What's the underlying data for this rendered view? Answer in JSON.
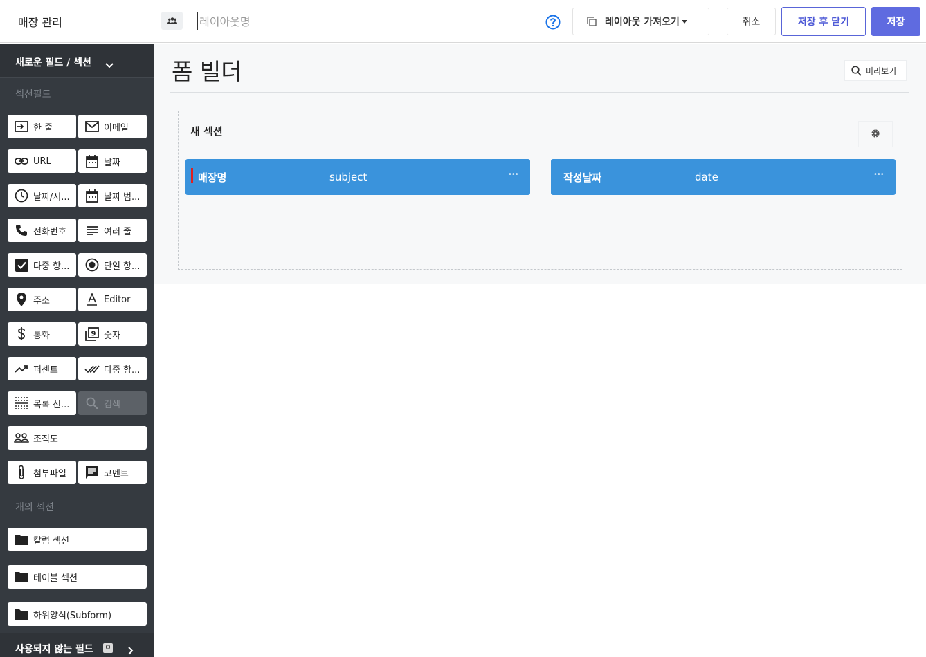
{
  "header": {
    "app_title": "매장 관리",
    "layout_name_value": "",
    "layout_name_placeholder": "레이아웃명",
    "import_label": "레이아웃 가져오기",
    "cancel_label": "취소",
    "save_close_label": "저장 후 닫기",
    "save_label": "저장"
  },
  "sidebar": {
    "header_label": "새로운 필드 / 섹션",
    "fields_category": "섹션필드",
    "fields": [
      {
        "label": "한 줄",
        "icon": "single-line-icon"
      },
      {
        "label": "이메일",
        "icon": "email-icon"
      },
      {
        "label": "URL",
        "icon": "link-icon"
      },
      {
        "label": "날짜",
        "icon": "calendar-icon"
      },
      {
        "label": "날짜/시...",
        "icon": "clock-icon"
      },
      {
        "label": "날짜 범...",
        "icon": "calendar-range-icon"
      },
      {
        "label": "전화번호",
        "icon": "phone-icon"
      },
      {
        "label": "여러 줄",
        "icon": "multiline-icon"
      },
      {
        "label": "다중 항...",
        "icon": "checkbox-icon"
      },
      {
        "label": "단일 항...",
        "icon": "radio-icon"
      },
      {
        "label": "주소",
        "icon": "location-pin-icon"
      },
      {
        "label": "Editor",
        "icon": "text-format-icon"
      },
      {
        "label": "통화",
        "icon": "dollar-icon"
      },
      {
        "label": "숫자",
        "icon": "number-icon"
      },
      {
        "label": "퍼센트",
        "icon": "trending-icon"
      },
      {
        "label": "다중 항...",
        "icon": "double-check-icon"
      },
      {
        "label": "목록 선...",
        "icon": "list-select-icon"
      },
      {
        "label": "검색",
        "icon": "search-icon",
        "disabled": true
      },
      {
        "label": "조직도",
        "icon": "people-icon"
      },
      {
        "label": "첨부파일",
        "icon": "paperclip-icon"
      },
      {
        "label": "코멘트",
        "icon": "comment-icon"
      }
    ],
    "sections_category": "개의 섹션",
    "sections": [
      {
        "label": "칼럼 섹션",
        "icon": "folder-icon"
      },
      {
        "label": "테이블 섹션",
        "icon": "folder-icon"
      },
      {
        "label": "하위양식(Subform)",
        "icon": "folder-icon"
      }
    ],
    "unused_label": "사용되지 않는 필드",
    "unused_count": "0"
  },
  "main": {
    "page_title": "폼 빌더",
    "preview_label": "미리보기",
    "section": {
      "title": "새 섹션",
      "fields": [
        {
          "label": "매장명",
          "key": "subject",
          "required": true
        },
        {
          "label": "작성날짜",
          "key": "date",
          "required": false
        }
      ]
    }
  },
  "colors": {
    "sidebar_bg": "#353a40",
    "primary_button": "#5f6be0",
    "field_chip": "#3a93dc",
    "required_marker": "#e02020"
  }
}
